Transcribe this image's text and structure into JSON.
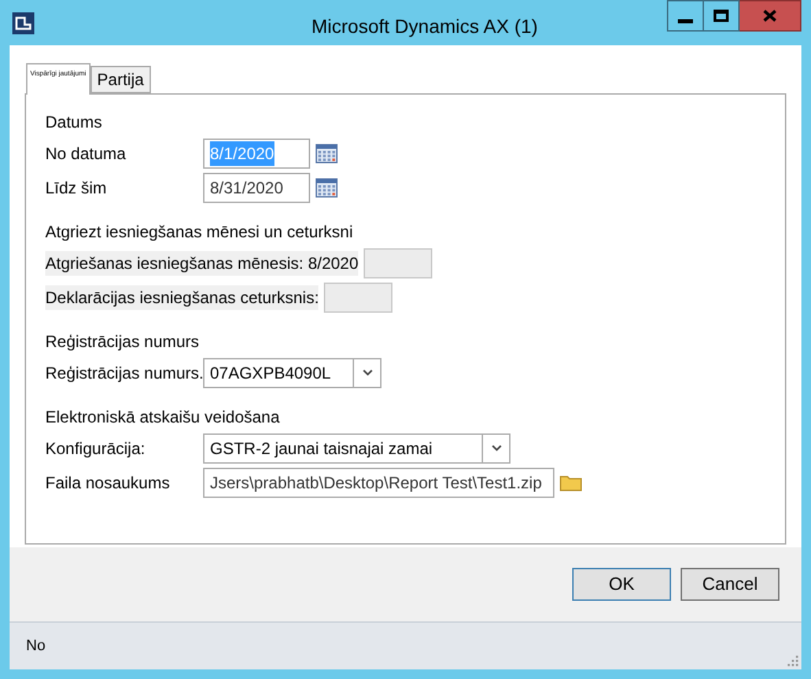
{
  "window": {
    "title": "Microsoft Dynamics AX (1)"
  },
  "tabs": [
    {
      "label": "Vispārīgi jautājumi",
      "selected": true
    },
    {
      "label": "Partija",
      "selected": false
    }
  ],
  "sections": [
    {
      "title": "Datums",
      "rows": [
        {
          "kind": "date",
          "label": "No datuma",
          "value": "8/1/2020",
          "highlighted": true
        },
        {
          "kind": "date",
          "label": "Līdz šim",
          "value": "8/31/2020",
          "highlighted": false
        }
      ]
    },
    {
      "title": "Atgriezt iesniegšanas mēnesi un ceturksni",
      "rows": [
        {
          "kind": "readonly",
          "label": "Atgriešanas iesniegšanas mēnesis: 8/2020"
        },
        {
          "kind": "readonly",
          "label": "Deklarācijas iesniegšanas ceturksnis:"
        }
      ]
    },
    {
      "title": "Reģistrācijas numurs",
      "rows": [
        {
          "kind": "combo",
          "label": "Reģistrācijas numurs.",
          "value": "07AGXPB4090L"
        }
      ]
    },
    {
      "title": "Elektroniskā atskaišu veidošana",
      "rows": [
        {
          "kind": "combo",
          "label": "Konfigurācija:",
          "value": "GSTR-2 jaunai taisnajai zamai",
          "wide": true
        },
        {
          "kind": "file",
          "label": "Faila nosaukums",
          "value": "Jsers\\prabhatb\\Desktop\\Report Test\\Test1.zip"
        }
      ]
    }
  ],
  "buttons": [
    "OK",
    "Cancel"
  ],
  "status_bar": {
    "text": "No"
  }
}
